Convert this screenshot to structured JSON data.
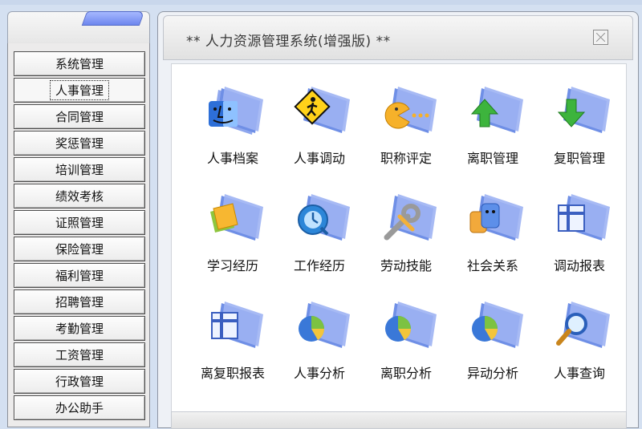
{
  "window": {
    "title": "**  人力资源管理系统(增强版)  **"
  },
  "sidebar": {
    "items": [
      {
        "label": "系统管理",
        "icon": ""
      },
      {
        "label": "人事管理",
        "active": true
      },
      {
        "label": "合同管理"
      },
      {
        "label": "奖惩管理"
      },
      {
        "label": "培训管理"
      },
      {
        "label": "绩效考核"
      },
      {
        "label": "证照管理"
      },
      {
        "label": "保险管理"
      },
      {
        "label": "福利管理"
      },
      {
        "label": "招聘管理"
      },
      {
        "label": "考勤管理"
      },
      {
        "label": "工资管理"
      },
      {
        "label": "行政管理"
      },
      {
        "label": "办公助手"
      }
    ]
  },
  "modules": [
    {
      "label": "人事档案",
      "icon": "finder-face-icon"
    },
    {
      "label": "人事调动",
      "icon": "pedestrian-sign-icon"
    },
    {
      "label": "职称评定",
      "icon": "pacman-icon"
    },
    {
      "label": "离职管理",
      "icon": "up-arrow-icon"
    },
    {
      "label": "复职管理",
      "icon": "down-arrow-icon"
    },
    {
      "label": "学习经历",
      "icon": "books-icon"
    },
    {
      "label": "工作经历",
      "icon": "quicktime-icon"
    },
    {
      "label": "劳动技能",
      "icon": "wrench-icon"
    },
    {
      "label": "社会关系",
      "icon": "faces-icon"
    },
    {
      "label": "调动报表",
      "icon": "table-report-icon"
    },
    {
      "label": "离复职报表",
      "icon": "table-report-icon"
    },
    {
      "label": "人事分析",
      "icon": "pie-chart-icon"
    },
    {
      "label": "离职分析",
      "icon": "pie-chart-icon"
    },
    {
      "label": "异动分析",
      "icon": "pie-chart-icon"
    },
    {
      "label": "人事查询",
      "icon": "magnifier-icon"
    }
  ],
  "colors": {
    "folder_blue": "#6f8fe6",
    "active_outline": "#222222"
  }
}
